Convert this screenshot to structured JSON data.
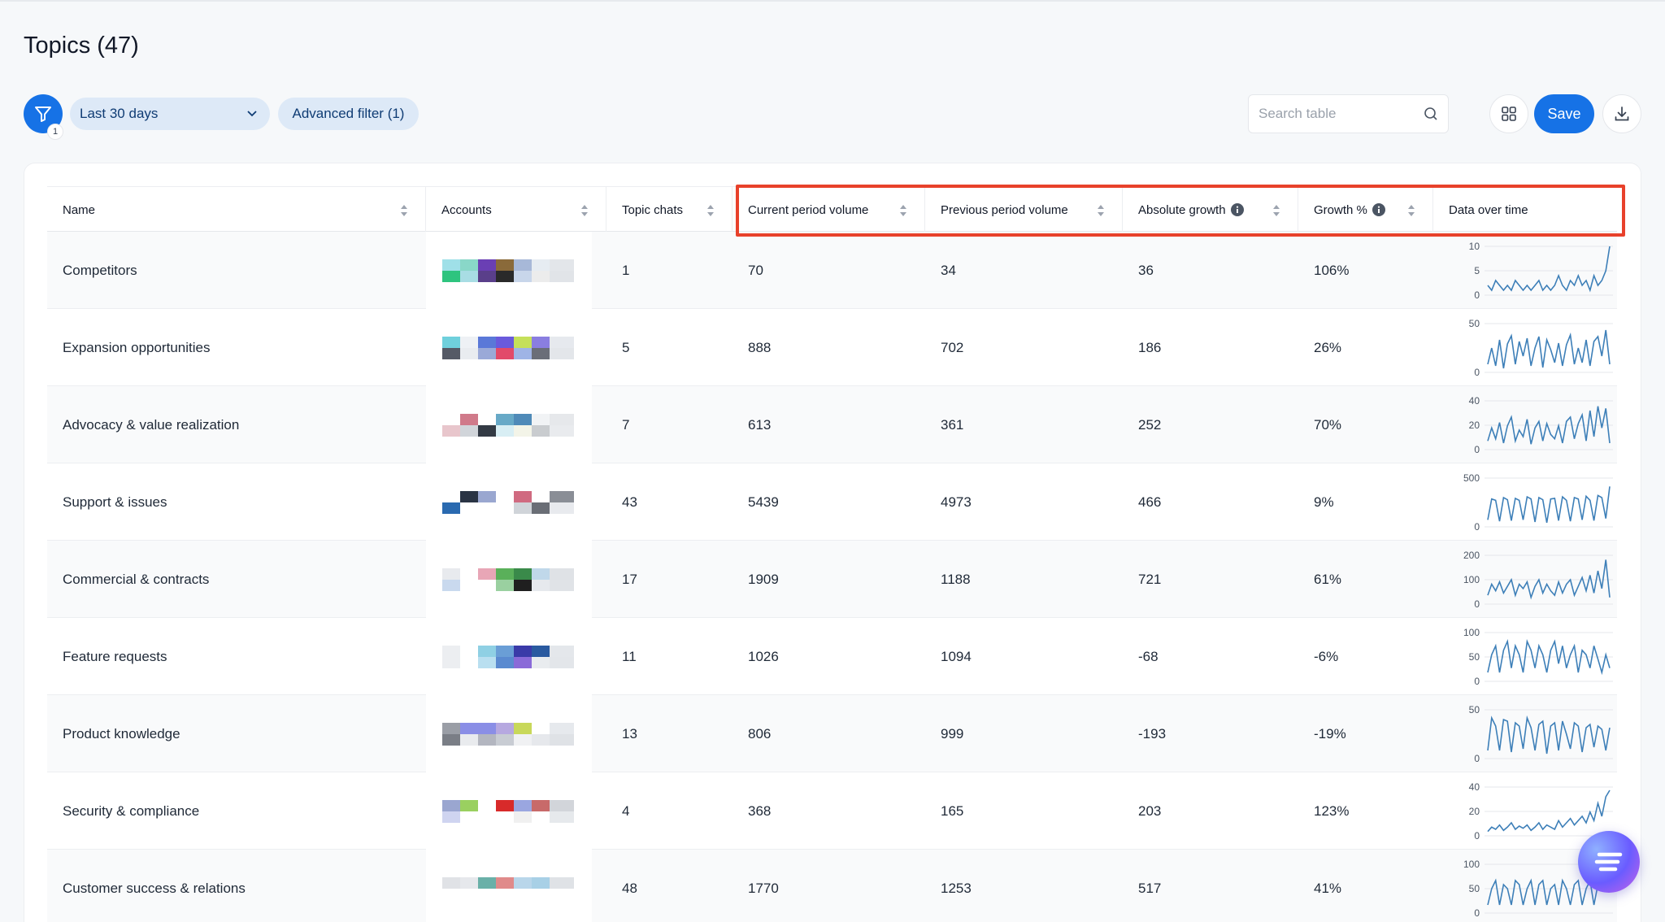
{
  "page": {
    "title": "Topics (47)"
  },
  "toolbar": {
    "filter_badge": "1",
    "date_range": "Last 30 days",
    "advanced_filter": "Advanced filter (1)",
    "search_placeholder": "Search table",
    "save_label": "Save"
  },
  "table": {
    "headers": {
      "name": "Name",
      "accounts": "Accounts",
      "topic_chats": "Topic chats",
      "current": "Current period volume",
      "previous": "Previous period volume",
      "abs_growth": "Absolute growth",
      "growth_pct": "Growth %",
      "data_over_time": "Data over time"
    },
    "rows": [
      {
        "name": "Competitors",
        "topic_chats": "1",
        "current": "70",
        "previous": "34",
        "abs_growth": "36",
        "growth_pct": "106%",
        "mosaic": [
          "#9fe0e8",
          "#89d7c8",
          "#6a3fb4",
          "#8a6a3a",
          "#a7b8d8",
          "#e6ecf2",
          "#e3e6ea",
          "#2ec47f",
          "#a8dde4",
          "#5a3f8a",
          "#2a2a2a",
          "#c8d6ea",
          "#ececec",
          "#e1e4e8"
        ],
        "spark": {
          "yticks": [
            "10",
            "5",
            "0"
          ],
          "max": 10,
          "values": [
            2,
            1,
            3,
            2,
            1,
            2,
            1,
            3,
            2,
            1,
            2,
            1,
            2,
            3,
            1,
            2,
            1,
            2,
            4,
            2,
            1,
            3,
            2,
            4,
            2,
            3,
            1,
            4,
            2,
            3,
            5,
            10
          ]
        }
      },
      {
        "name": "Expansion opportunities",
        "topic_chats": "5",
        "current": "888",
        "previous": "702",
        "abs_growth": "186",
        "growth_pct": "26%",
        "mosaic": [
          "#6fd0dc",
          "#eef1f5",
          "#5a78d8",
          "#6a5adc",
          "#c5e05a",
          "#8a7ee0",
          "#e6e9ee",
          "#555a66",
          "#e9ecf0",
          "#9aa9d8",
          "#e24a6a",
          "#9fb4e6",
          "#6a6e78",
          "#e3e6ea"
        ],
        "spark": {
          "yticks": [
            "50",
            "0"
          ],
          "max": 60,
          "values": [
            10,
            30,
            8,
            40,
            5,
            35,
            45,
            10,
            38,
            20,
            42,
            8,
            30,
            44,
            6,
            40,
            28,
            12,
            36,
            8,
            34,
            46,
            10,
            30,
            12,
            40,
            8,
            38,
            44,
            20,
            52,
            10
          ]
        }
      },
      {
        "name": "Advocacy & value realization",
        "topic_chats": "7",
        "current": "613",
        "previous": "361",
        "abs_growth": "252",
        "growth_pct": "70%",
        "mosaic": [
          "#ffffff",
          "#d07a8a",
          "#ffffff",
          "#67a9c7",
          "#4f8ab8",
          "#f1f3f5",
          "#e6e8eb",
          "#e8c6cc",
          "#d1d5da",
          "#333a44",
          "#d8eef4",
          "#f3f4e8",
          "#c9cccf",
          "#e9ebee"
        ],
        "spark": {
          "yticks": [
            "40",
            "20",
            "0"
          ],
          "max": 45,
          "values": [
            8,
            20,
            10,
            25,
            6,
            22,
            30,
            8,
            18,
            12,
            28,
            5,
            20,
            26,
            8,
            24,
            14,
            10,
            22,
            6,
            26,
            30,
            10,
            24,
            32,
            8,
            36,
            12,
            40,
            20,
            38,
            6
          ]
        }
      },
      {
        "name": "Support & issues",
        "topic_chats": "43",
        "current": "5439",
        "previous": "4973",
        "abs_growth": "466",
        "growth_pct": "9%",
        "mosaic": [
          "#ffffff",
          "#2a3444",
          "#9aa7d0",
          "#ffffff",
          "#d06a80",
          "#ffffff",
          "#8a8e96",
          "#2a6ab0",
          "#ffffff",
          "#ffffff",
          "#ffffff",
          "#d0d4d9",
          "#6a6e76",
          "#e8eaee"
        ],
        "spark": {
          "yticks": [
            "500",
            "0"
          ],
          "max": 700,
          "values": [
            100,
            400,
            380,
            80,
            420,
            390,
            90,
            410,
            380,
            100,
            430,
            400,
            70,
            420,
            390,
            60,
            400,
            410,
            90,
            430,
            380,
            80,
            420,
            400,
            100,
            440,
            380,
            90,
            450,
            420,
            120,
            580
          ]
        }
      },
      {
        "name": "Commercial & contracts",
        "topic_chats": "17",
        "current": "1909",
        "previous": "1188",
        "abs_growth": "721",
        "growth_pct": "61%",
        "mosaic": [
          "#e8eaee",
          "#ffffff",
          "#e8a6b6",
          "#5ab05a",
          "#3a8a4a",
          "#c0d8ea",
          "#dfe2e6",
          "#c9d9ee",
          "#ffffff",
          "#ffffff",
          "#9ad0a0",
          "#1f1f1f",
          "#e6e9ed",
          "#e0e3e7"
        ],
        "spark": {
          "yticks": [
            "200",
            "100",
            "0"
          ],
          "max": 220,
          "values": [
            40,
            90,
            60,
            100,
            50,
            80,
            110,
            40,
            90,
            70,
            100,
            30,
            80,
            110,
            50,
            90,
            60,
            40,
            100,
            50,
            90,
            110,
            40,
            80,
            120,
            60,
            130,
            50,
            150,
            70,
            200,
            30
          ]
        }
      },
      {
        "name": "Feature requests",
        "topic_chats": "11",
        "current": "1026",
        "previous": "1094",
        "abs_growth": "-68",
        "growth_pct": "-6%",
        "mosaic": [
          "#eceef1",
          "#ffffff",
          "#8fd0e4",
          "#6a9ed6",
          "#3a3aa8",
          "#2a5aa0",
          "#e4e7eb",
          "#eceef1",
          "#ffffff",
          "#b9dff0",
          "#5a8ad0",
          "#8a6ad8",
          "#e9ecef",
          "#e3e6ea"
        ],
        "spark": {
          "yticks": [
            "100",
            "50",
            "0"
          ],
          "max": 110,
          "values": [
            20,
            60,
            80,
            20,
            70,
            90,
            30,
            80,
            60,
            20,
            90,
            70,
            30,
            80,
            60,
            20,
            70,
            90,
            40,
            80,
            30,
            60,
            80,
            20,
            70,
            60,
            30,
            80,
            50,
            20,
            60,
            30
          ]
        }
      },
      {
        "name": "Product knowledge",
        "topic_chats": "13",
        "current": "806",
        "previous": "999",
        "abs_growth": "-193",
        "growth_pct": "-19%",
        "mosaic": [
          "#9a9ea6",
          "#8a8ee6",
          "#8a8ee6",
          "#b6a8e0",
          "#c8d85a",
          "#ffffff",
          "#e6e9ed",
          "#7a7e86",
          "#e9ebee",
          "#b3b6c0",
          "#c8ccd3",
          "#f0f1f3",
          "#e6e8ec",
          "#dfe2e6"
        ],
        "spark": {
          "yticks": [
            "50",
            "0"
          ],
          "max": 60,
          "values": [
            10,
            50,
            40,
            10,
            48,
            46,
            8,
            44,
            40,
            12,
            50,
            38,
            10,
            42,
            46,
            6,
            40,
            44,
            10,
            46,
            30,
            12,
            44,
            40,
            8,
            38,
            42,
            14,
            40,
            36,
            10,
            38
          ]
        }
      },
      {
        "name": "Security & compliance",
        "topic_chats": "4",
        "current": "368",
        "previous": "165",
        "abs_growth": "203",
        "growth_pct": "123%",
        "mosaic": [
          "#9aa6d0",
          "#9ad060",
          "#ffffff",
          "#d82a2a",
          "#9aa6e0",
          "#c86a6a",
          "#d2d5da",
          "#cfd4f0",
          "#ffffff",
          "#ffffff",
          "#ffffff",
          "#f0f0f0",
          "#ffffff",
          "#e6e9ec"
        ],
        "spark": {
          "yticks": [
            "40",
            "20",
            "0"
          ],
          "max": 45,
          "values": [
            4,
            8,
            6,
            10,
            5,
            8,
            12,
            6,
            9,
            7,
            10,
            5,
            8,
            12,
            6,
            10,
            8,
            6,
            14,
            8,
            12,
            16,
            10,
            14,
            18,
            12,
            22,
            14,
            30,
            18,
            36,
            42
          ]
        }
      },
      {
        "name": "Customer success & relations",
        "topic_chats": "48",
        "current": "1770",
        "previous": "1253",
        "abs_growth": "517",
        "growth_pct": "41%",
        "mosaic": [
          "#e0e2e6",
          "#e6e8ec",
          "#6ab0a8",
          "#e08a8a",
          "#b9d6ea",
          "#a8d0e6",
          "#dfe2e6",
          "#ffffff",
          "#ffffff",
          "#ffffff",
          "#ffffff",
          "#ffffff",
          "#ffffff",
          "#ffffff"
        ],
        "spark": {
          "yticks": [
            "100",
            "50",
            "0"
          ],
          "max": 120,
          "values": [
            20,
            60,
            80,
            20,
            70,
            60,
            20,
            80,
            70,
            20,
            60,
            80,
            20,
            70,
            80,
            20,
            60,
            70,
            20,
            80,
            60,
            20,
            70,
            80,
            20,
            60,
            80,
            20,
            70,
            60,
            90,
            110
          ]
        }
      }
    ]
  }
}
